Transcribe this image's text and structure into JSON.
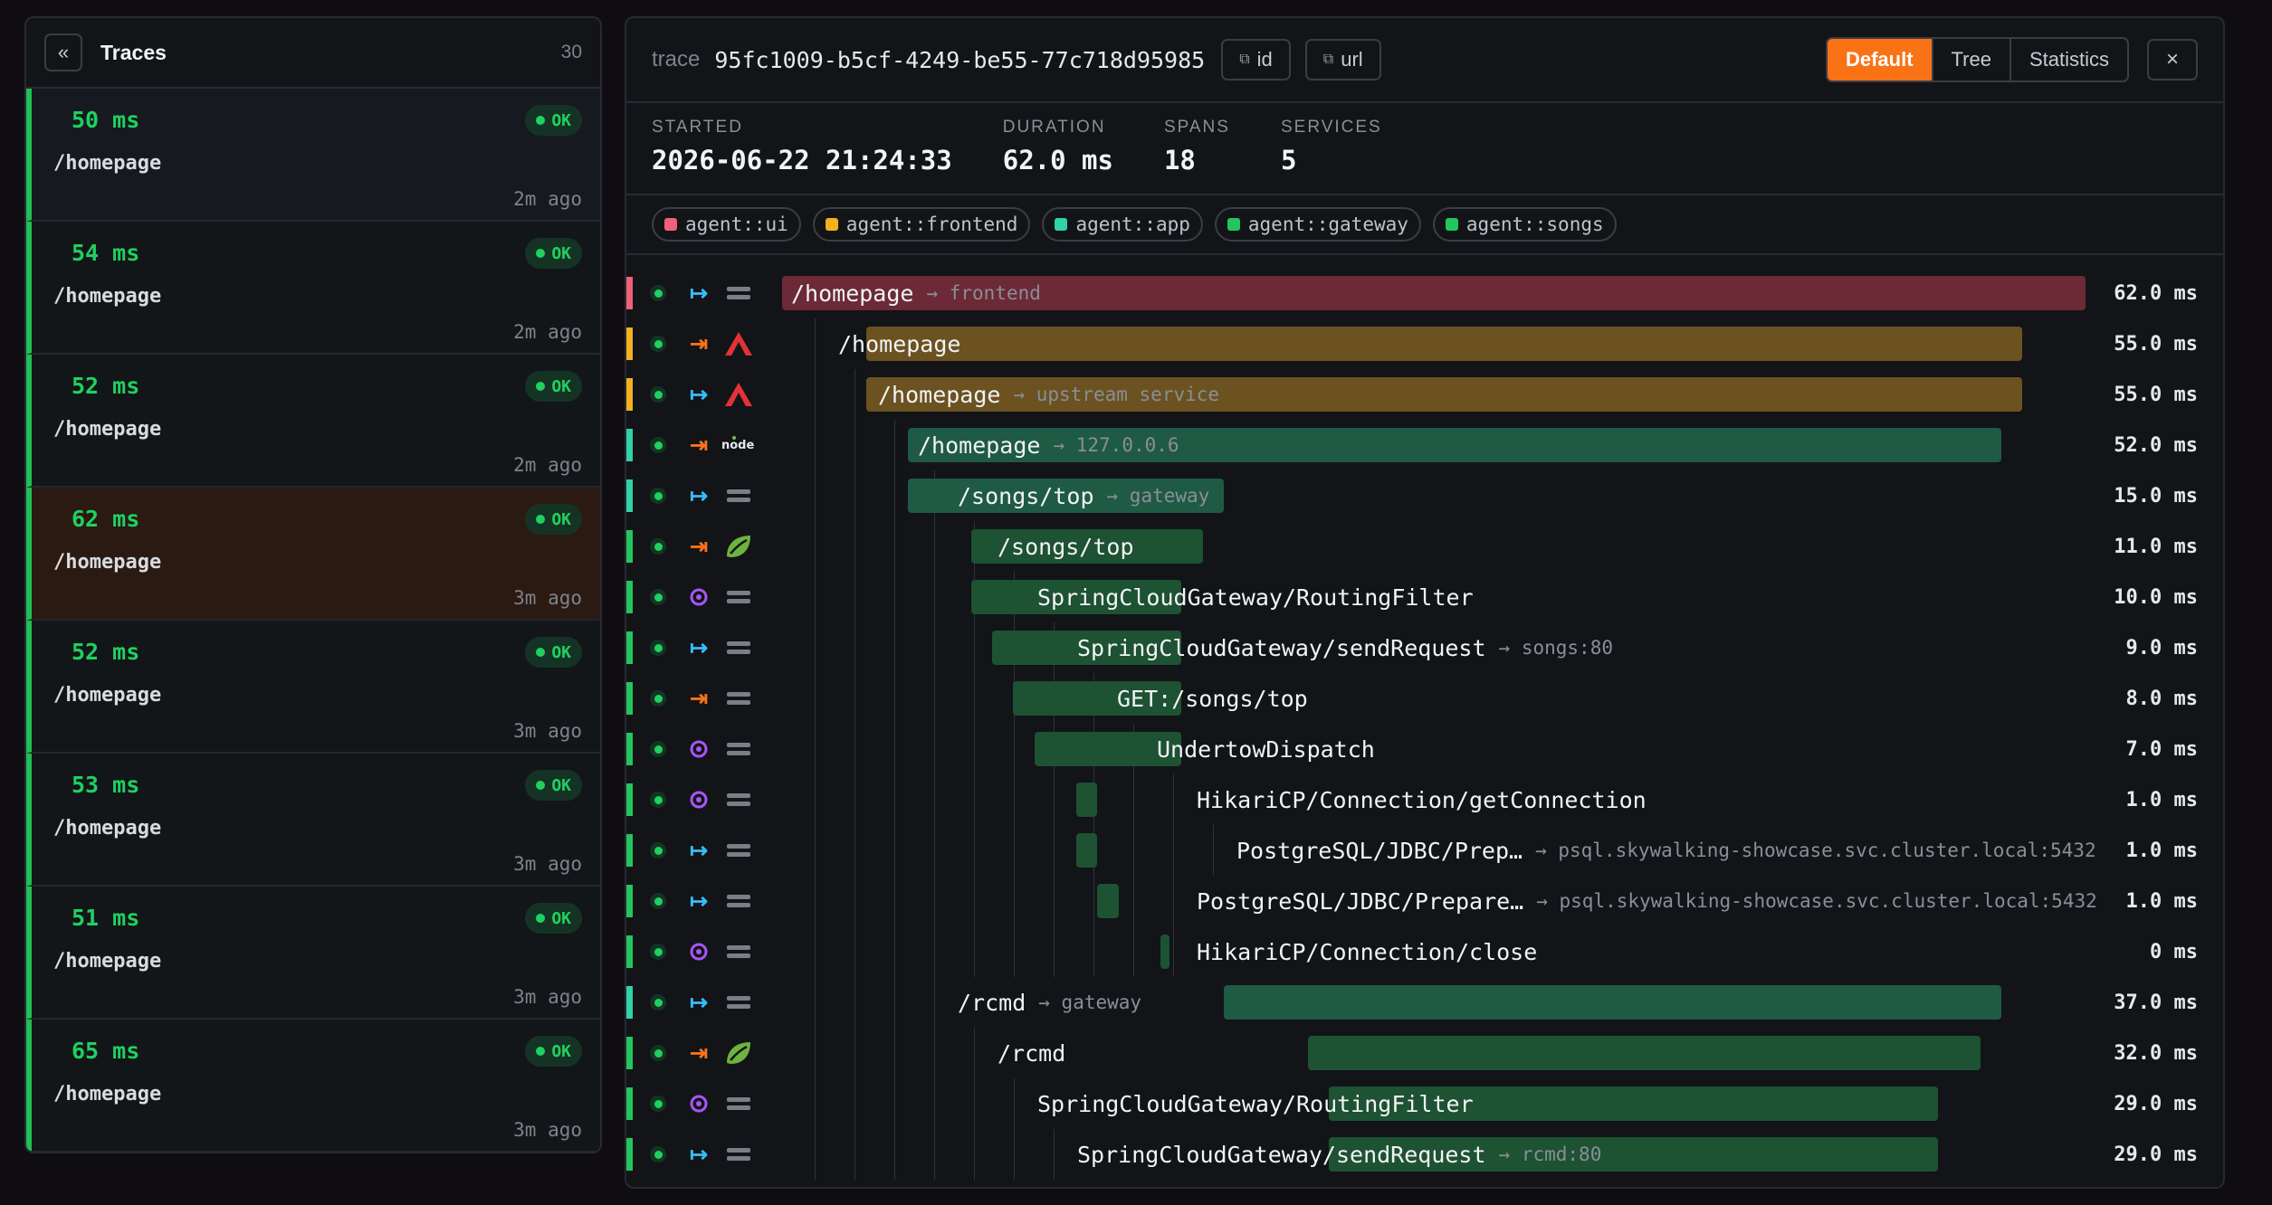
{
  "left_panel": {
    "collapse_label": "«",
    "title": "Traces",
    "count": "30",
    "traces": [
      {
        "duration": "50 ms",
        "status": "OK",
        "path": "/homepage",
        "ago": "2m ago"
      },
      {
        "duration": "54 ms",
        "status": "OK",
        "path": "/homepage",
        "ago": "2m ago"
      },
      {
        "duration": "52 ms",
        "status": "OK",
        "path": "/homepage",
        "ago": "2m ago"
      },
      {
        "duration": "62 ms",
        "status": "OK",
        "path": "/homepage",
        "ago": "3m ago",
        "selected": true
      },
      {
        "duration": "52 ms",
        "status": "OK",
        "path": "/homepage",
        "ago": "3m ago"
      },
      {
        "duration": "53 ms",
        "status": "OK",
        "path": "/homepage",
        "ago": "3m ago"
      },
      {
        "duration": "51 ms",
        "status": "OK",
        "path": "/homepage",
        "ago": "3m ago"
      },
      {
        "duration": "65 ms",
        "status": "OK",
        "path": "/homepage",
        "ago": "3m ago"
      }
    ]
  },
  "header": {
    "trace_label": "trace",
    "trace_id": "95fc1009-b5cf-4249-be55-77c718d95985",
    "copy_id_label": "id",
    "copy_url_label": "url",
    "copy_icon": "⧉",
    "views": [
      "Default",
      "Tree",
      "Statistics"
    ],
    "active_view": "Default",
    "close_label": "×"
  },
  "stats": [
    {
      "label": "STARTED",
      "value": "2026-06-22 21:24:33"
    },
    {
      "label": "DURATION",
      "value": "62.0 ms"
    },
    {
      "label": "SPANS",
      "value": "18"
    },
    {
      "label": "SERVICES",
      "value": "5"
    }
  ],
  "services": [
    {
      "name": "agent::ui",
      "color": "#f0607a"
    },
    {
      "name": "agent::frontend",
      "color": "#f2b21e"
    },
    {
      "name": "agent::app",
      "color": "#2fd3a8"
    },
    {
      "name": "agent::gateway",
      "color": "#22c55e"
    },
    {
      "name": "agent::songs",
      "color": "#22c55e"
    }
  ],
  "trace_total_ms": 62,
  "spans": [
    {
      "name": "/homepage",
      "peer": "→ frontend",
      "kind": "entry",
      "component": "generic",
      "depth": 0,
      "start": 0,
      "dur": 62,
      "dur_label": "62.0 ms",
      "color": "#f0607a",
      "bar": "#6b2a35"
    },
    {
      "name": "/homepage",
      "peer": "",
      "kind": "exit",
      "component": "angular",
      "depth": 1,
      "start": 4,
      "dur": 55,
      "dur_label": "55.0 ms",
      "color": "#f2b21e",
      "bar": "#6b5220"
    },
    {
      "name": "/homepage",
      "peer": "→ upstream service",
      "kind": "entry",
      "component": "angular",
      "depth": 2,
      "start": 4,
      "dur": 55,
      "dur_label": "55.0 ms",
      "color": "#f2b21e",
      "bar": "#6b5220"
    },
    {
      "name": "/homepage",
      "peer": "→ 127.0.0.6",
      "kind": "exit",
      "component": "node",
      "depth": 3,
      "start": 6,
      "dur": 52,
      "dur_label": "52.0 ms",
      "color": "#2fd3a8",
      "bar": "#1f5a44"
    },
    {
      "name": "/songs/top",
      "peer": "→ gateway",
      "kind": "entry",
      "component": "generic",
      "depth": 4,
      "start": 6,
      "dur": 15,
      "dur_label": "15.0 ms",
      "color": "#2fd3a8",
      "bar": "#1f5a44"
    },
    {
      "name": "/songs/top",
      "peer": "",
      "kind": "exit",
      "component": "spring",
      "depth": 5,
      "start": 9,
      "dur": 11,
      "dur_label": "11.0 ms",
      "color": "#22c55e",
      "bar": "#1d5233"
    },
    {
      "name": "SpringCloudGateway/RoutingFilter",
      "peer": "",
      "kind": "local",
      "component": "generic",
      "depth": 6,
      "start": 9,
      "dur": 10,
      "dur_label": "10.0 ms",
      "color": "#22c55e",
      "bar": "#1d5233"
    },
    {
      "name": "SpringCloudGateway/sendRequest",
      "peer": "→ songs:80",
      "kind": "entry",
      "component": "generic",
      "depth": 7,
      "start": 10,
      "dur": 9,
      "dur_label": "9.0 ms",
      "color": "#22c55e",
      "bar": "#1d5233"
    },
    {
      "name": "GET:/songs/top",
      "peer": "",
      "kind": "exit",
      "component": "generic",
      "depth": 8,
      "start": 11,
      "dur": 8,
      "dur_label": "8.0 ms",
      "color": "#22c55e",
      "bar": "#1d5233"
    },
    {
      "name": "UndertowDispatch",
      "peer": "",
      "kind": "local",
      "component": "generic",
      "depth": 9,
      "start": 12,
      "dur": 7,
      "dur_label": "7.0 ms",
      "color": "#22c55e",
      "bar": "#1d5233"
    },
    {
      "name": "HikariCP/Connection/getConnection",
      "peer": "",
      "kind": "local",
      "component": "generic",
      "depth": 10,
      "start": 14,
      "dur": 1,
      "dur_label": "1.0 ms",
      "color": "#22c55e",
      "bar": "#1d5233"
    },
    {
      "name": "PostgreSQL/JDBC/Prep…",
      "peer": "→ psql.skywalking-showcase.svc.cluster.local:5432",
      "kind": "entry",
      "component": "generic",
      "depth": 11,
      "start": 14,
      "dur": 1,
      "dur_label": "1.0 ms",
      "color": "#22c55e",
      "bar": "#1d5233"
    },
    {
      "name": "PostgreSQL/JDBC/Prepare…",
      "peer": "→ psql.skywalking-showcase.svc.cluster.local:5432",
      "kind": "entry",
      "component": "generic",
      "depth": 10,
      "start": 15,
      "dur": 1,
      "dur_label": "1.0 ms",
      "color": "#22c55e",
      "bar": "#1d5233"
    },
    {
      "name": "HikariCP/Connection/close",
      "peer": "",
      "kind": "local",
      "component": "generic",
      "depth": 10,
      "start": 18,
      "dur": 0,
      "dur_label": "0 ms",
      "color": "#22c55e",
      "bar": "#1d5233"
    },
    {
      "name": "/rcmd",
      "peer": "→ gateway",
      "kind": "entry",
      "component": "generic",
      "depth": 4,
      "start": 21,
      "dur": 37,
      "dur_label": "37.0 ms",
      "color": "#2fd3a8",
      "bar": "#1f5a44"
    },
    {
      "name": "/rcmd",
      "peer": "",
      "kind": "exit",
      "component": "spring",
      "depth": 5,
      "start": 25,
      "dur": 32,
      "dur_label": "32.0 ms",
      "color": "#22c55e",
      "bar": "#1d5233"
    },
    {
      "name": "SpringCloudGateway/RoutingFilter",
      "peer": "",
      "kind": "local",
      "component": "generic",
      "depth": 6,
      "start": 26,
      "dur": 29,
      "dur_label": "29.0 ms",
      "color": "#22c55e",
      "bar": "#1d5233"
    },
    {
      "name": "SpringCloudGateway/sendRequest",
      "peer": "→ rcmd:80",
      "kind": "entry",
      "component": "generic",
      "depth": 7,
      "start": 26,
      "dur": 29,
      "dur_label": "29.0 ms",
      "color": "#22c55e",
      "bar": "#1d5233"
    }
  ]
}
